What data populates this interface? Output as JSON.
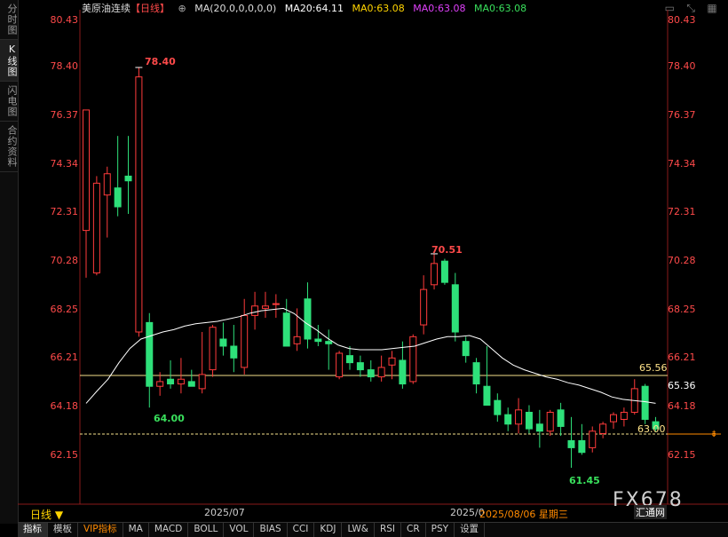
{
  "side_tabs": [
    "分时图",
    "K线图",
    "闪电图",
    "合约资料"
  ],
  "header": {
    "title": "美原油连续",
    "period": "【日线】",
    "gear": "⊕",
    "ma_params": "MA(20,0,0,0,0,0)",
    "ma20": "MA20:64.11",
    "ma_a": "MA0:63.08",
    "ma_b": "MA0:63.08",
    "ma_c": "MA0:63.08"
  },
  "price_levels": [
    "80.43",
    "78.40",
    "76.37",
    "74.34",
    "72.31",
    "70.28",
    "68.25",
    "66.21",
    "64.18",
    "62.15"
  ],
  "markers": {
    "high": "78.40",
    "low1": "64.00",
    "peak2": "70.51",
    "low2": "61.45",
    "line_upper": "65.56",
    "line_current": "65.36",
    "line_lower": "63.00"
  },
  "period_button": "日线 ▼",
  "x_labels": [
    "2025/07",
    "2025/0"
  ],
  "date_readout": "2025/08/06 星期三",
  "watermark": "FX678",
  "watermark_sub": "汇通网",
  "bottom_tabs": [
    "指标",
    "模板",
    "VIP指标",
    "MA",
    "MACD",
    "BOLL",
    "VOL",
    "BIAS",
    "CCI",
    "KDJ",
    "LW&",
    "RSI",
    "CR",
    "PSY",
    "设置"
  ],
  "colors": {
    "up": "#ff3b3b",
    "down": "#2ee07a",
    "ma": "#ffffff",
    "level_line": "#ffe38a"
  },
  "chart_data": {
    "type": "candlestick",
    "y_range": [
      61.15,
      80.43
    ],
    "x_labels": [
      "2025/07",
      "2025/0"
    ],
    "candles": [
      {
        "o": 71.5,
        "h": 75.3,
        "l": 69.5,
        "c": 76.6
      },
      {
        "o": 69.7,
        "h": 73.8,
        "l": 69.6,
        "c": 73.5
      },
      {
        "o": 73.0,
        "h": 74.2,
        "l": 71.2,
        "c": 73.9
      },
      {
        "o": 73.3,
        "h": 75.5,
        "l": 72.1,
        "c": 72.5
      },
      {
        "o": 73.8,
        "h": 75.5,
        "l": 72.2,
        "c": 73.6
      },
      {
        "o": 67.2,
        "h": 78.4,
        "l": 67.0,
        "c": 78.0
      },
      {
        "o": 67.6,
        "h": 68.0,
        "l": 64.0,
        "c": 64.9
      },
      {
        "o": 64.9,
        "h": 65.5,
        "l": 64.5,
        "c": 65.1
      },
      {
        "o": 65.2,
        "h": 66.0,
        "l": 64.8,
        "c": 65.0
      },
      {
        "o": 65.0,
        "h": 66.1,
        "l": 64.6,
        "c": 65.2
      },
      {
        "o": 65.1,
        "h": 65.6,
        "l": 64.9,
        "c": 64.9
      },
      {
        "o": 64.8,
        "h": 67.2,
        "l": 64.6,
        "c": 65.4
      },
      {
        "o": 65.6,
        "h": 67.5,
        "l": 65.3,
        "c": 67.4
      },
      {
        "o": 66.9,
        "h": 67.6,
        "l": 66.2,
        "c": 66.6
      },
      {
        "o": 66.6,
        "h": 67.5,
        "l": 65.5,
        "c": 66.1
      },
      {
        "o": 65.7,
        "h": 68.6,
        "l": 65.4,
        "c": 67.9
      },
      {
        "o": 67.9,
        "h": 68.9,
        "l": 67.3,
        "c": 68.3
      },
      {
        "o": 68.2,
        "h": 68.9,
        "l": 67.8,
        "c": 68.3
      },
      {
        "o": 68.4,
        "h": 68.8,
        "l": 67.8,
        "c": 68.4
      },
      {
        "o": 68.0,
        "h": 68.6,
        "l": 66.8,
        "c": 66.6
      },
      {
        "o": 66.7,
        "h": 68.2,
        "l": 66.4,
        "c": 67.0
      },
      {
        "o": 68.6,
        "h": 69.3,
        "l": 66.5,
        "c": 66.9
      },
      {
        "o": 66.9,
        "h": 67.5,
        "l": 66.6,
        "c": 66.8
      },
      {
        "o": 66.8,
        "h": 67.3,
        "l": 65.6,
        "c": 66.7
      },
      {
        "o": 65.3,
        "h": 66.4,
        "l": 65.2,
        "c": 66.3
      },
      {
        "o": 66.2,
        "h": 66.6,
        "l": 65.6,
        "c": 65.9
      },
      {
        "o": 65.9,
        "h": 66.2,
        "l": 65.3,
        "c": 65.6
      },
      {
        "o": 65.6,
        "h": 66.0,
        "l": 65.1,
        "c": 65.3
      },
      {
        "o": 65.3,
        "h": 66.2,
        "l": 65.1,
        "c": 65.7
      },
      {
        "o": 65.8,
        "h": 66.4,
        "l": 65.2,
        "c": 66.1
      },
      {
        "o": 66.0,
        "h": 66.8,
        "l": 64.8,
        "c": 65.0
      },
      {
        "o": 65.1,
        "h": 67.1,
        "l": 65.0,
        "c": 67.0
      },
      {
        "o": 67.5,
        "h": 69.6,
        "l": 67.1,
        "c": 69.0
      },
      {
        "o": 69.2,
        "h": 70.5,
        "l": 69.0,
        "c": 70.1
      },
      {
        "o": 70.2,
        "h": 70.3,
        "l": 69.2,
        "c": 69.3
      },
      {
        "o": 69.2,
        "h": 69.7,
        "l": 66.8,
        "c": 67.2
      },
      {
        "o": 66.8,
        "h": 67.0,
        "l": 65.9,
        "c": 66.2
      },
      {
        "o": 65.9,
        "h": 66.1,
        "l": 64.6,
        "c": 65.0
      },
      {
        "o": 64.9,
        "h": 66.6,
        "l": 64.2,
        "c": 64.1
      },
      {
        "o": 64.3,
        "h": 64.6,
        "l": 63.4,
        "c": 63.7
      },
      {
        "o": 63.7,
        "h": 64.0,
        "l": 63.0,
        "c": 63.3
      },
      {
        "o": 63.3,
        "h": 64.4,
        "l": 62.9,
        "c": 63.9
      },
      {
        "o": 63.8,
        "h": 64.1,
        "l": 62.9,
        "c": 63.1
      },
      {
        "o": 63.3,
        "h": 63.9,
        "l": 62.3,
        "c": 63.0
      },
      {
        "o": 63.0,
        "h": 63.9,
        "l": 62.8,
        "c": 63.8
      },
      {
        "o": 63.9,
        "h": 64.2,
        "l": 62.8,
        "c": 63.2
      },
      {
        "o": 62.6,
        "h": 63.6,
        "l": 61.45,
        "c": 62.3
      },
      {
        "o": 62.6,
        "h": 63.3,
        "l": 62.0,
        "c": 62.1
      },
      {
        "o": 62.3,
        "h": 63.2,
        "l": 62.1,
        "c": 63.0
      },
      {
        "o": 62.9,
        "h": 63.4,
        "l": 62.7,
        "c": 63.3
      },
      {
        "o": 63.4,
        "h": 63.8,
        "l": 63.1,
        "c": 63.7
      },
      {
        "o": 63.5,
        "h": 64.0,
        "l": 63.2,
        "c": 63.8
      },
      {
        "o": 63.8,
        "h": 65.2,
        "l": 63.7,
        "c": 64.8
      },
      {
        "o": 64.9,
        "h": 65.0,
        "l": 63.3,
        "c": 63.5
      },
      {
        "o": 63.4,
        "h": 63.6,
        "l": 63.0,
        "c": 63.1
      }
    ],
    "ma20": [
      64.18,
      64.7,
      65.2,
      65.9,
      66.5,
      66.9,
      67.05,
      67.2,
      67.3,
      67.45,
      67.55,
      67.6,
      67.65,
      67.75,
      67.85,
      68.0,
      68.1,
      68.15,
      68.2,
      67.98,
      67.6,
      67.3,
      66.95,
      66.65,
      66.5,
      66.45,
      66.45,
      66.45,
      66.5,
      66.55,
      66.6,
      66.75,
      66.9,
      67.0,
      67.0,
      67.05,
      66.9,
      66.5,
      66.1,
      65.8,
      65.6,
      65.45,
      65.3,
      65.2,
      65.05,
      64.95,
      64.8,
      64.65,
      64.45,
      64.35,
      64.3,
      64.25,
      64.18
    ]
  }
}
